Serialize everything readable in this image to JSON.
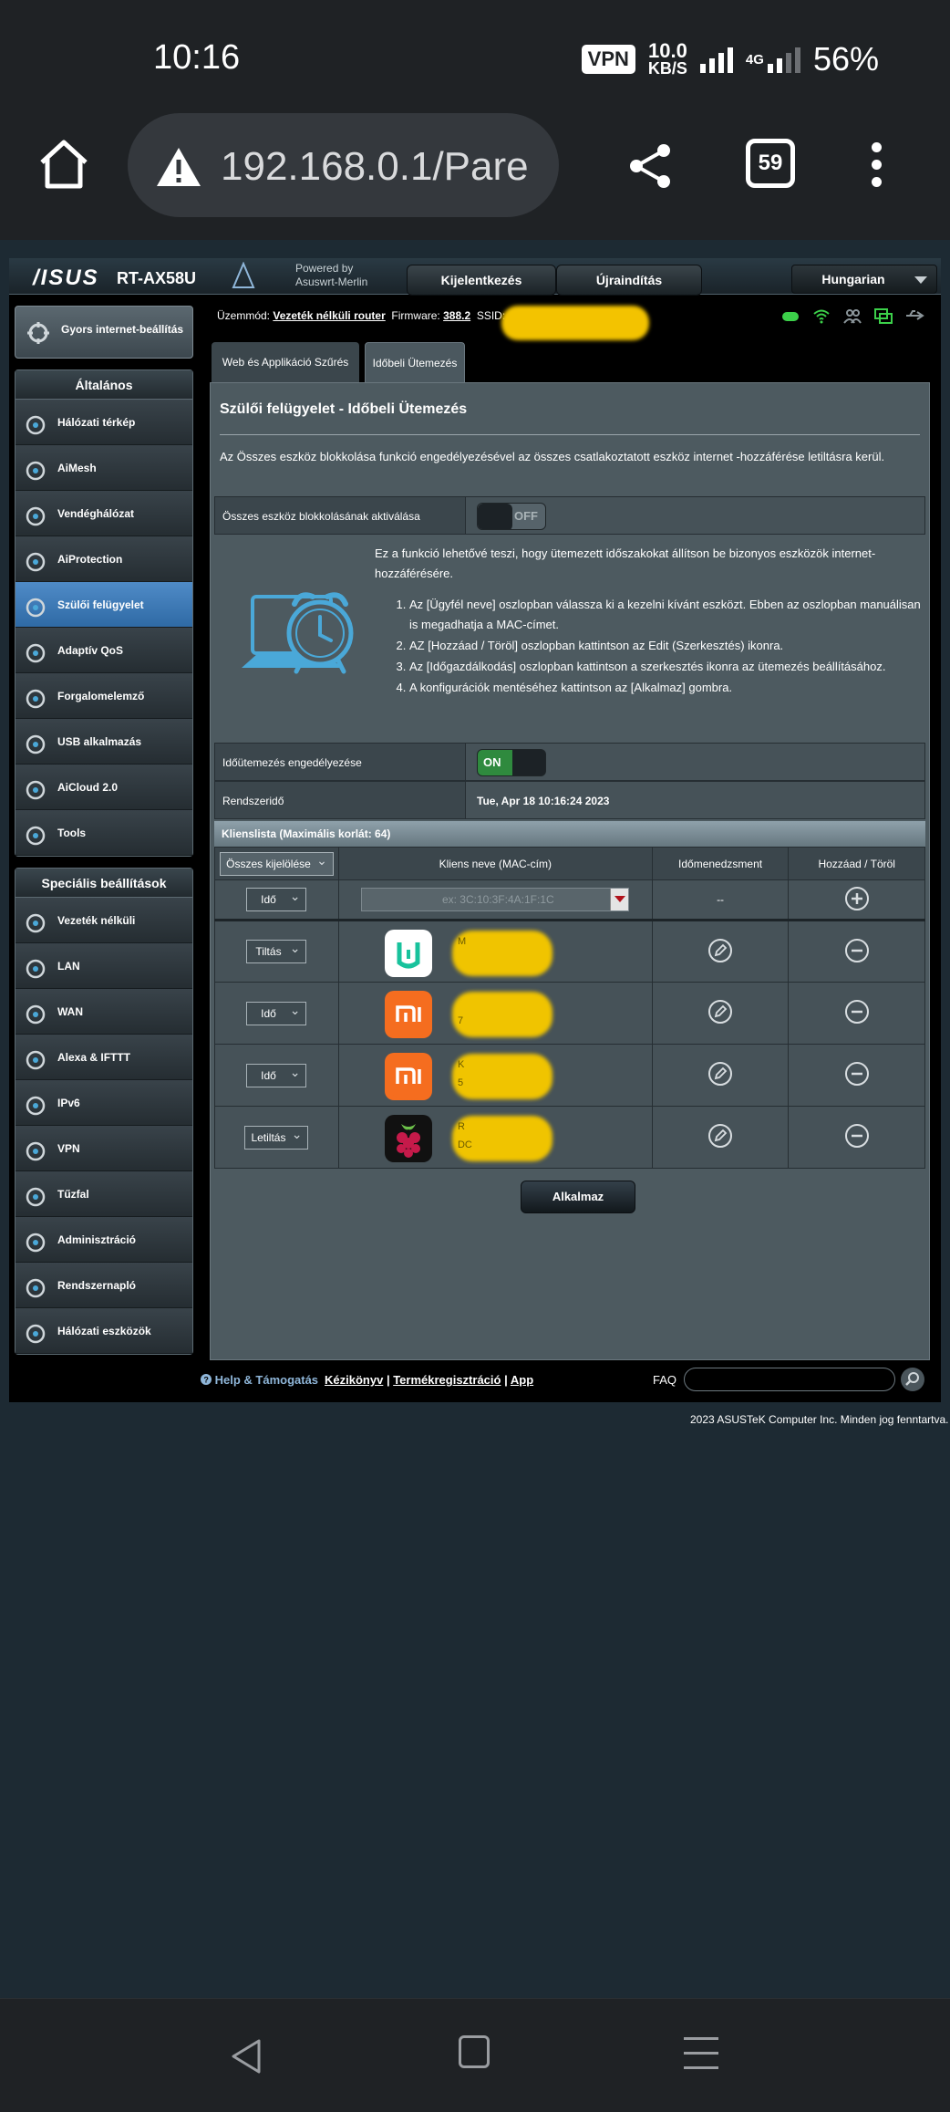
{
  "status_bar": {
    "time": "10:16",
    "vpn": "VPN",
    "speed_value": "10.0",
    "speed_unit": "KB/S",
    "network": "4G",
    "battery": "56%"
  },
  "browser": {
    "url": "192.168.0.1/Pare",
    "tab_count": "59"
  },
  "router": {
    "logo": "/ISUS",
    "model": "RT-AX58U",
    "powered_line1": "Powered by",
    "powered_line2": "Asuswrt-Merlin",
    "logout": "Kijelentkezés",
    "reboot": "Újraindítás",
    "language": "Hungarian",
    "mode_label": "Üzemmód:",
    "mode_value": "Vezeték nélküli router",
    "firmware_label": "Firmware:",
    "firmware_value": "388.2",
    "ssid_label": "SSID:"
  },
  "sidebar": {
    "quick_setup": "Gyors internet-beállítás",
    "general_title": "Általános",
    "general_items": [
      {
        "label": "Hálózati térkép",
        "icon": "network-map-icon"
      },
      {
        "label": "AiMesh",
        "icon": "aimesh-icon"
      },
      {
        "label": "Vendéghálózat",
        "icon": "guest-network-icon"
      },
      {
        "label": "AiProtection",
        "icon": "aiprotection-icon"
      },
      {
        "label": "Szülői felügyelet",
        "icon": "parental-control-icon"
      },
      {
        "label": "Adaptív QoS",
        "icon": "qos-icon"
      },
      {
        "label": "Forgalomelemző",
        "icon": "traffic-analyzer-icon"
      },
      {
        "label": "USB alkalmazás",
        "icon": "usb-icon"
      },
      {
        "label": "AiCloud 2.0",
        "icon": "aicloud-icon"
      },
      {
        "label": "Tools",
        "icon": "wrench-icon"
      }
    ],
    "advanced_title": "Speciális beállítások",
    "advanced_items": [
      {
        "label": "Vezeték nélküli",
        "icon": "wireless-icon"
      },
      {
        "label": "LAN",
        "icon": "lan-icon"
      },
      {
        "label": "WAN",
        "icon": "wan-icon"
      },
      {
        "label": "Alexa & IFTTT",
        "icon": "alexa-icon"
      },
      {
        "label": "IPv6",
        "icon": "ipv6-icon"
      },
      {
        "label": "VPN",
        "icon": "vpn-icon"
      },
      {
        "label": "Tűzfal",
        "icon": "firewall-icon"
      },
      {
        "label": "Adminisztráció",
        "icon": "admin-icon"
      },
      {
        "label": "Rendszernapló",
        "icon": "syslog-icon"
      },
      {
        "label": "Hálózati eszközök",
        "icon": "network-tools-icon"
      }
    ]
  },
  "tabs": {
    "web_filter": "Web és Applikáció Szűrés",
    "time_schedule": "Időbeli Ütemezés"
  },
  "main": {
    "title": "Szülői felügyelet - Időbeli Ütemezés",
    "description": "Az Összes eszköz blokkolása funkció engedélyezésével az összes csatlakoztatott eszköz internet -hozzáférése letiltásra kerül.",
    "block_all_label": "Összes eszköz blokkolásának aktiválása",
    "block_all_state": "OFF",
    "feature_intro": "Ez a funkció lehetővé teszi, hogy ütemezett időszakokat állítson be bizonyos eszközök internet-hozzáférésére.",
    "steps": [
      "Az [Ügyfél neve] oszlopban válassza ki a kezelni kívánt eszközt. Ebben az oszlopban manuálisan is megadhatja a MAC-címet.",
      "AZ [Hozzáad / Töröl] oszlopban kattintson az Edit (Szerkesztés) ikonra.",
      "Az [Időgazdálkodás] oszlopban kattintson a szerkesztés ikonra az ütemezés beállításához.",
      "A konfigurációk mentéséhez kattintson az [Alkalmaz] gombra."
    ],
    "schedule_enable_label": "Időütemezés engedélyezése",
    "schedule_enable_state": "ON",
    "system_time_label": "Rendszeridő",
    "system_time_value": "Tue, Apr 18 10:16:24 2023"
  },
  "client_list": {
    "title": "Klienslista (Maximális korlát: 64)",
    "headers": {
      "select_all": "Összes kijelölése",
      "client_name": "Kliens neve (MAC-cím)",
      "time_management": "Időmenedzsment",
      "add_delete": "Hozzáad / Töröl"
    },
    "add_row": {
      "mode": "Idő",
      "mac_placeholder": "ex: 3C:10:3F:4A:1F:1C",
      "time": "--"
    },
    "rows": [
      {
        "mode": "Tiltás",
        "logo": "mi-home-icon",
        "name": "M",
        "mac": "",
        "logo_bg": "#ffffff"
      },
      {
        "mode": "Idő",
        "logo": "xiaomi-icon",
        "name": "",
        "mac": "7",
        "logo_bg": "#f56d1f"
      },
      {
        "mode": "Idő",
        "logo": "xiaomi-icon",
        "name": "K",
        "mac": "5",
        "logo_bg": "#f56d1f"
      },
      {
        "mode": "Letiltás",
        "logo": "raspberry-pi-icon",
        "name": "R",
        "mac": "DC",
        "logo_bg": "#111111"
      }
    ],
    "apply": "Alkalmaz"
  },
  "footer": {
    "help": "Help & Támogatás",
    "manual": "Kézikönyv",
    "sep1": "|",
    "registration": "Termékregisztráció",
    "sep2": "|",
    "app": "App",
    "faq": "FAQ",
    "copyright": "2023 ASUSTeK Computer Inc. Minden jog fenntartva."
  },
  "colors": {
    "active_item": "#3f7cba",
    "toggle_on": "#2f8a3e",
    "redaction": "#f3c300"
  }
}
